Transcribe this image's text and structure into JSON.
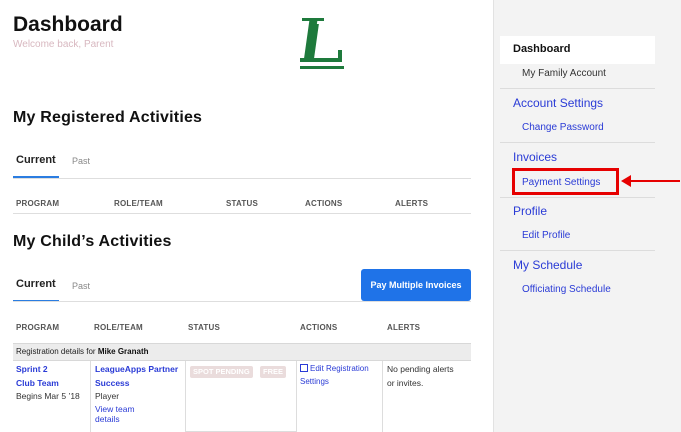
{
  "header": {
    "title": "Dashboard",
    "welcome": "Welcome back, Parent",
    "logo_letter": "L"
  },
  "registered": {
    "title": "My Registered Activities",
    "tabs": [
      "Current",
      "Past"
    ],
    "columns": [
      "PROGRAM",
      "ROLE/TEAM",
      "STATUS",
      "ACTIONS",
      "ALERTS"
    ]
  },
  "child": {
    "title": "My Child’s Activities",
    "tabs": [
      "Current",
      "Past"
    ],
    "pay_button": "Pay Multiple Invoices",
    "columns": [
      "PROGRAM",
      "ROLE/TEAM",
      "STATUS",
      "ACTIONS",
      "ALERTS"
    ],
    "registration_prefix": "Registration details for",
    "registrant": "Mike Granath",
    "row": {
      "program_line1": "Sprint 2",
      "program_line2": "Club Team",
      "begins": "Begins Mar 5 ’18",
      "team_line1": "LeagueApps Partner",
      "team_line2": "Success",
      "role": "Player",
      "view_team_line1": "View team",
      "view_team_line2": "details",
      "status_pending": "SPOT PENDING",
      "status_free": "FREE",
      "action_line1": "Edit Registration",
      "action_line2": "Settings",
      "alerts_line1": "No pending alerts",
      "alerts_line2": "or invites."
    }
  },
  "sidebar": {
    "dashboard": "Dashboard",
    "family_account": "My Family Account",
    "account_settings": "Account Settings",
    "change_password": "Change Password",
    "invoices": "Invoices",
    "payment_settings": "Payment Settings",
    "profile": "Profile",
    "edit_profile": "Edit Profile",
    "my_schedule": "My Schedule",
    "officiating_schedule": "Officiating Schedule"
  },
  "colors": {
    "accent": "#1f73e8",
    "link": "#2a3bd6",
    "logo_green": "#1e7a3c",
    "annotation_red": "#e60000"
  }
}
